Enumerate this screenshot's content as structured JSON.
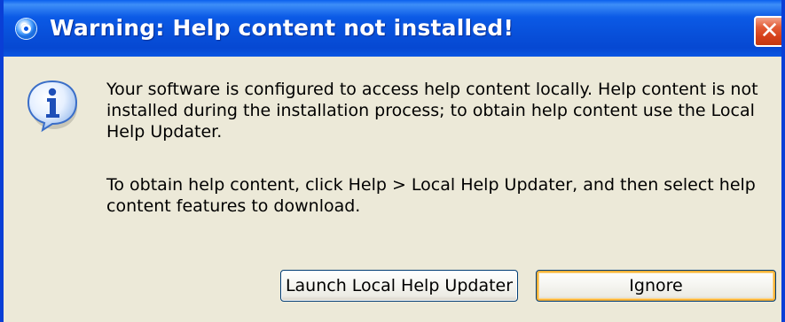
{
  "window": {
    "title": "Warning: Help content not installed!",
    "title_icon": "dialog-app-icon",
    "close_glyph": "✕"
  },
  "dialog": {
    "icon": "info-icon",
    "message_1": "Your software is configured to access help content locally.  Help content is not installed during the installation process; to obtain help content use the Local Help Updater.",
    "message_2": "To obtain help content, click Help > Local Help Updater, and then select help content features to download."
  },
  "buttons": {
    "launch_label": "Launch Local Help Updater",
    "ignore_label": "Ignore"
  },
  "colors": {
    "titlebar": "#0B56E2",
    "window_face": "#ECE9D8",
    "close_button": "#D5401A",
    "default_button_focus": "#F8B33A"
  }
}
